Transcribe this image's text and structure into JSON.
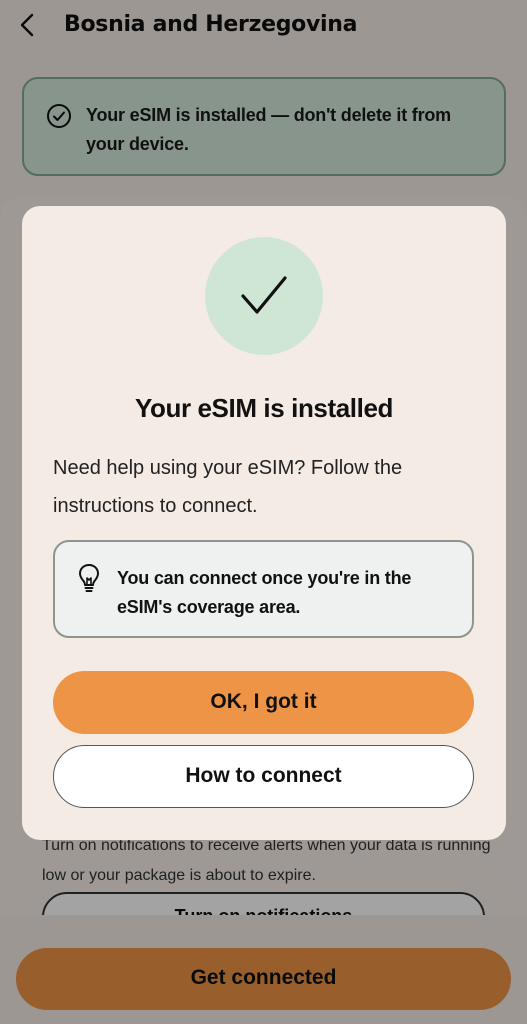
{
  "header": {
    "title": "Bosnia and Herzegovina",
    "back_icon": "chevron-left-icon"
  },
  "banner": {
    "text": "Your eSIM is installed — don't delete it from your device.",
    "icon": "check-circle-icon"
  },
  "background": {
    "notifications_text": "Turn on notifications to receive alerts when your data is running low or your package is about to expire.",
    "notifications_button": "Turn on notifications",
    "cta_button": "Get connected"
  },
  "modal": {
    "icon": "checkmark-icon",
    "title": "Your eSIM is installed",
    "description": "Need help using your eSIM? Follow the instructions to connect.",
    "tip": {
      "icon": "lightbulb-icon",
      "text": "You can connect once you're in the eSIM's coverage area."
    },
    "primary_button": "OK, I got it",
    "secondary_button": "How to connect"
  },
  "colors": {
    "accent_orange": "#ee9446",
    "success_green": "#cfe6d5",
    "banner_border": "#7fae8f",
    "modal_bg": "#f4ebe4"
  }
}
